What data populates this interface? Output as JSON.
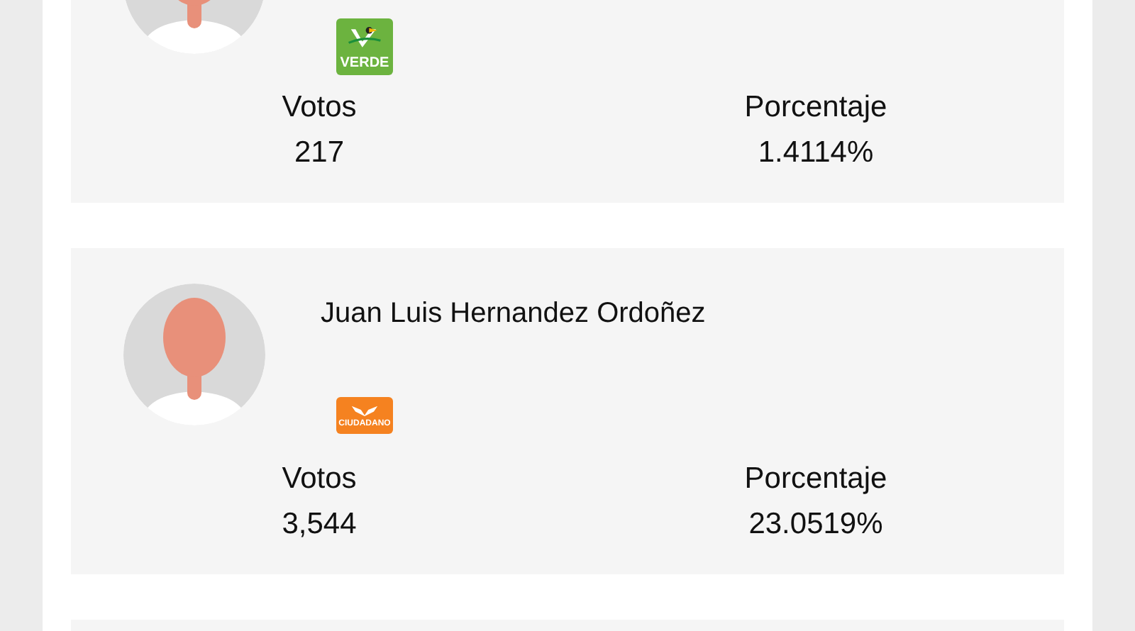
{
  "candidates": [
    {
      "kind": "candidate",
      "party": {
        "kind": "verde",
        "text": "VERDE"
      },
      "votes_label": "Votos",
      "votes": "217",
      "percent_label": "Porcentaje",
      "percent": "1.4114%"
    },
    {
      "kind": "candidate",
      "name": "Juan Luis Hernandez Ordoñez",
      "party": {
        "kind": "movimiento",
        "text": "CIUDADANO"
      },
      "votes_label": "Votos",
      "votes": "3,544",
      "percent_label": "Porcentaje",
      "percent": "23.0519%"
    },
    {
      "kind": "cut_off"
    }
  ]
}
